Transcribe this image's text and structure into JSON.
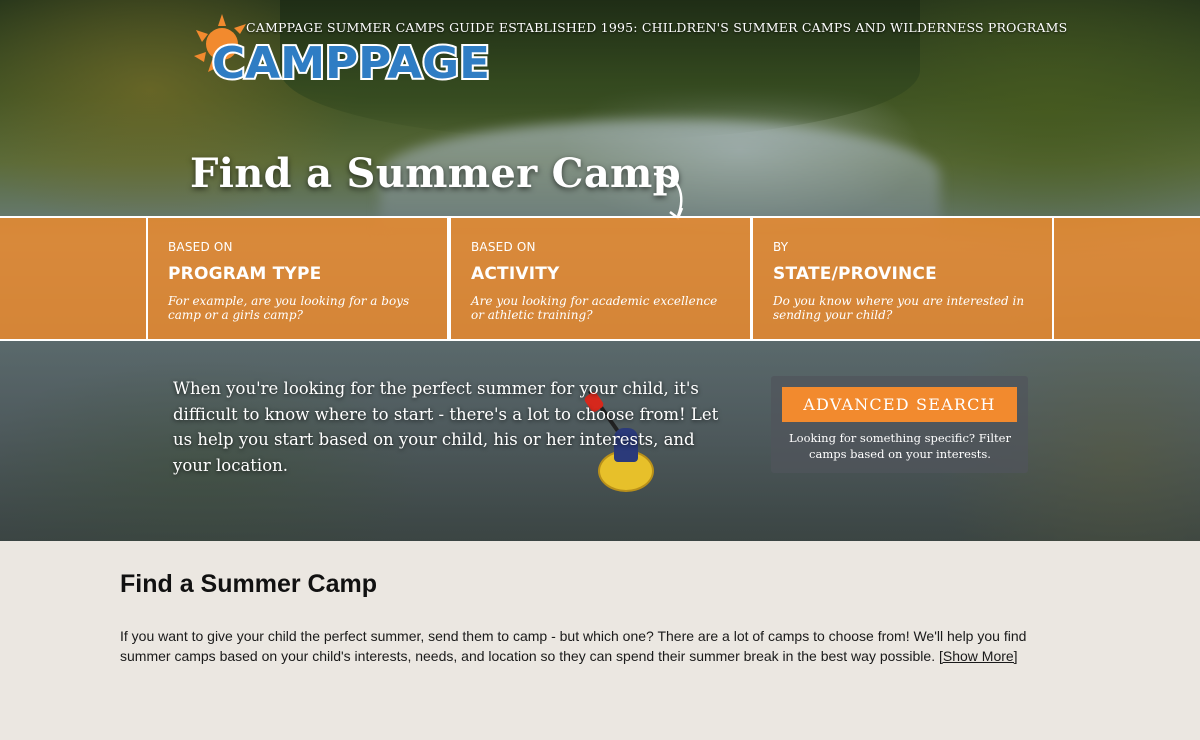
{
  "header": {
    "logo_text": "CAMPPAGE",
    "tagline": "CAMPPAGE SUMMER CAMPS GUIDE ESTABLISHED 1995: CHILDREN'S SUMMER CAMPS AND WILDERNESS PROGRAMS"
  },
  "hero": {
    "title": "Find a Summer Camp",
    "copy": "When you're looking for the perfect summer for your child, it's difficult to know where to start - there's a lot to choose from! Let us help you start based on your child, his or her interests, and your location."
  },
  "search_tiles": [
    {
      "small": "BASED ON",
      "big": "PROGRAM TYPE",
      "desc": "For example, are you looking for a boys camp or a girls camp?"
    },
    {
      "small": "BASED ON",
      "big": "ACTIVITY",
      "desc": "Are you looking for academic excellence or athletic training?"
    },
    {
      "small": "BY",
      "big": "STATE/PROVINCE",
      "desc": "Do you know where you are interested in sending your child?"
    }
  ],
  "advanced_search": {
    "button_label": "ADVANCED SEARCH",
    "note": "Looking for something specific? Filter camps based on your interests."
  },
  "content": {
    "title": "Find a Summer Camp",
    "body": "If you want to give your child the perfect summer, send them to camp - but which one? There are a lot of camps to choose from! We'll help you find summer camps based on your child's interests, needs, and location so they can spend their summer break in the best way possible.",
    "show_more": "[Show More]"
  },
  "colors": {
    "accent_orange": "#f28a2e",
    "strip_orange": "#ea8b2e",
    "logo_blue": "#2f7dc4",
    "page_bg": "#ebe7e1"
  },
  "icons": {
    "logo": "sun-logo-icon",
    "title_arrow": "curved-arrow-down-icon"
  }
}
